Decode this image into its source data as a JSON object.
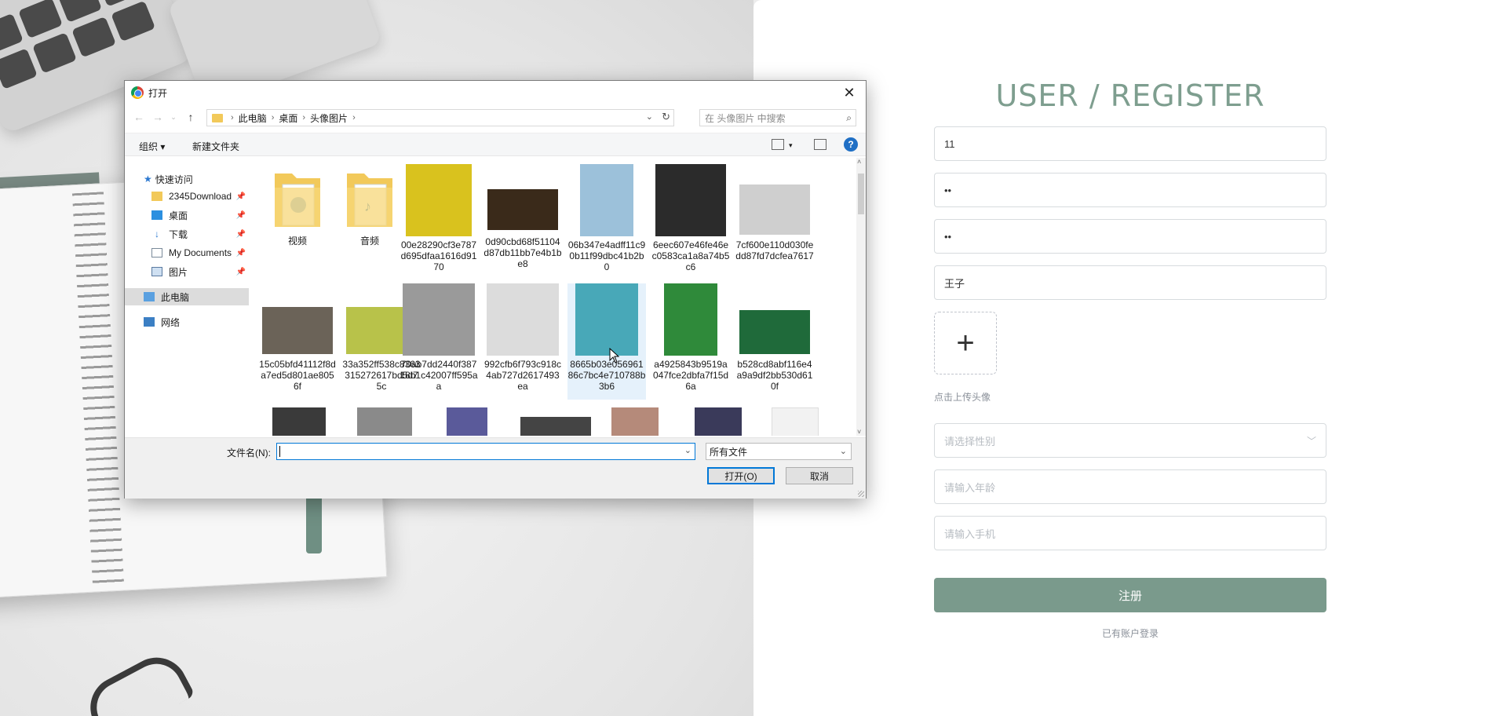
{
  "register": {
    "title": "USER / REGISTER",
    "username_value": "11",
    "password_value": "••",
    "confirm_value": "••",
    "nickname_value": "王子",
    "upload_hint": "点击上传头像",
    "gender_placeholder": "请选择性别",
    "age_placeholder": "请输入年龄",
    "phone_placeholder": "请输入手机",
    "submit_label": "注册",
    "login_link": "已有账户登录"
  },
  "dialog": {
    "title": "打开",
    "breadcrumb": [
      "此电脑",
      "桌面",
      "头像图片"
    ],
    "search_placeholder": "在 头像图片 中搜索",
    "organize": "组织",
    "new_folder": "新建文件夹",
    "nav": {
      "quick_access": "快速访问",
      "items": [
        "2345Download",
        "桌面",
        "下载",
        "My Documents",
        "图片"
      ],
      "this_pc": "此电脑",
      "network": "网络"
    },
    "files_row1": [
      {
        "name": "视频",
        "kind": "folder",
        "icon": "video-folder-icon"
      },
      {
        "name": "音频",
        "kind": "folder",
        "icon": "audio-folder-icon"
      },
      {
        "name": "00e28290cf3e787d695dfaa1616d9170",
        "kind": "image",
        "color": "#d9c21e"
      },
      {
        "name": "0d90cbd68f51104d87db11bb7e4b1be8",
        "kind": "image",
        "color": "#3a2a1a"
      },
      {
        "name": "06b347e4adff11c90b11f99dbc41b2b0",
        "kind": "image",
        "color": "#9cc1da"
      },
      {
        "name": "6eec607e46fe46ec0583ca1a8a74b5c6",
        "kind": "image",
        "color": "#2b2b2b"
      },
      {
        "name": "7cf600e110d030fedd87fd7dcfea7617",
        "kind": "image",
        "color": "#cfcfcf"
      }
    ],
    "files_row2": [
      {
        "name": "15c05bfd41112f8da7ed5d801ae8056f",
        "kind": "image",
        "color": "#6b6358"
      },
      {
        "name": "33a352ff538c8363315272617bd5d75c",
        "kind": "image",
        "color": "#b8c24a"
      },
      {
        "name": "70ab7dd2440f38718b1c42007ff595aa",
        "kind": "image",
        "color": "#9a9a9a"
      },
      {
        "name": "992cfb6f793c918c4ab727d2617493ea",
        "kind": "image",
        "color": "#dcdcdc"
      },
      {
        "name": "8665b03e05696186c7bc4e710788b3b6",
        "kind": "image",
        "color": "#48a8b8",
        "selected": true
      },
      {
        "name": "a4925843b9519a047fce2dbfa7f15d6a",
        "kind": "image",
        "color": "#2f8a3a"
      },
      {
        "name": "b528cd8abf116e4a9a9df2bb530d610f",
        "kind": "image",
        "color": "#1f6a3a"
      }
    ],
    "files_row3_colors": [
      "#3a3a3a",
      "#8a8a8a",
      "#5a5a9a",
      "#444444",
      "#b58a7a",
      "#3a3a5a",
      "#f2f2f2"
    ],
    "filename_label": "文件名(N):",
    "filename_value": "",
    "filetype_value": "所有文件",
    "open_label": "打开(O)",
    "cancel_label": "取消"
  }
}
